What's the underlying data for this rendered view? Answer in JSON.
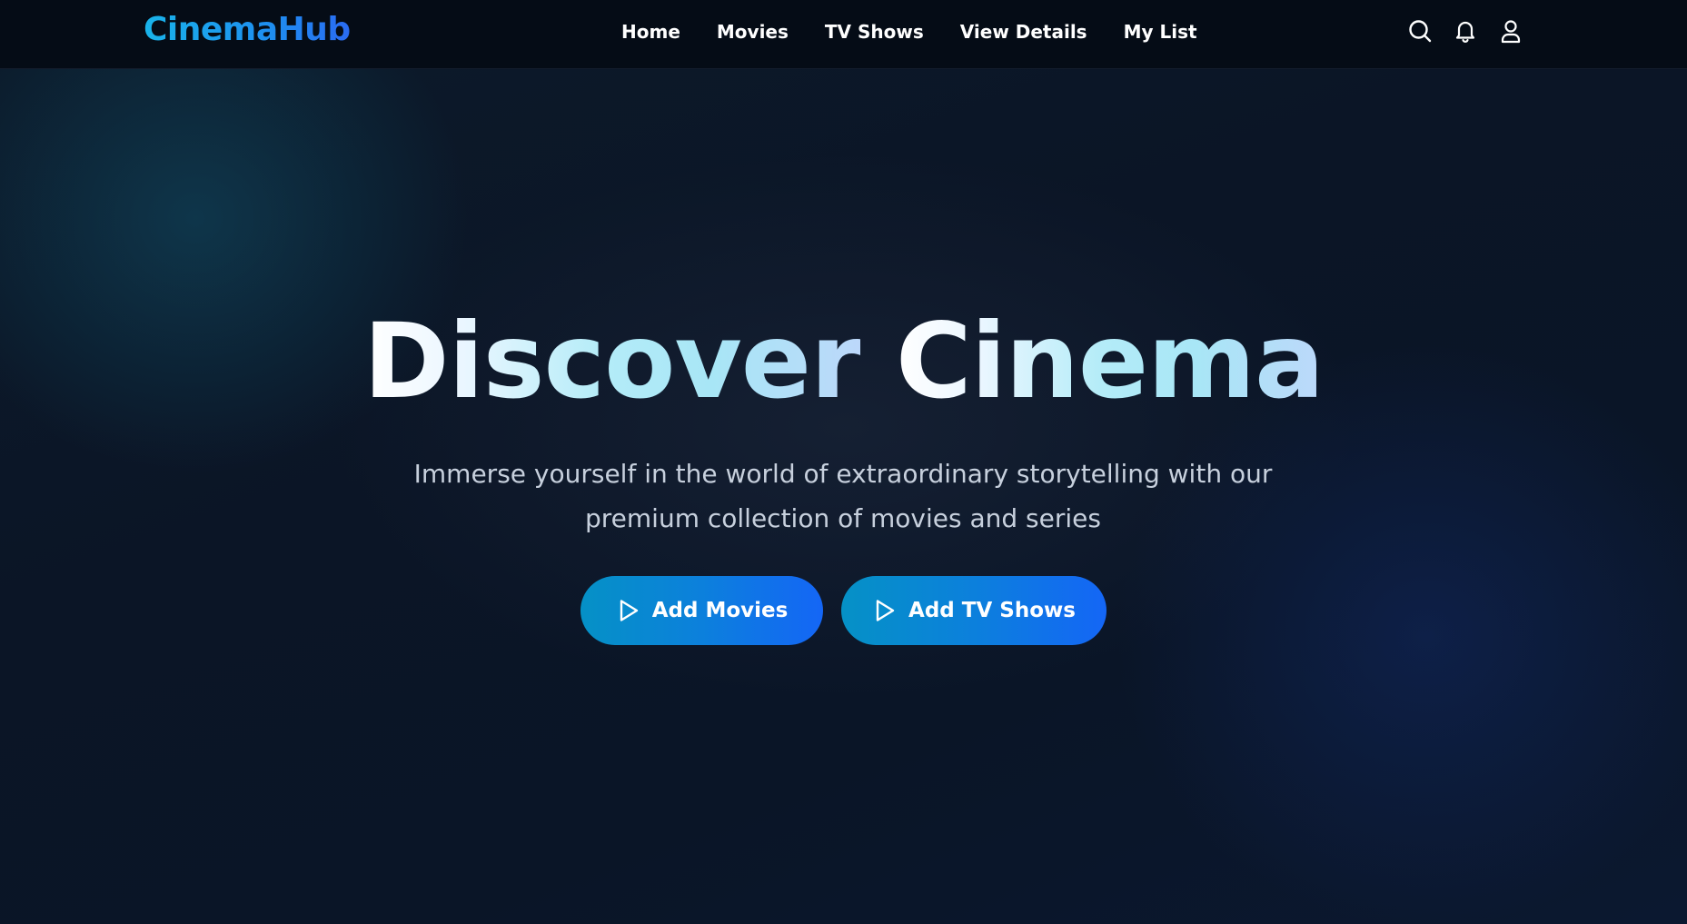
{
  "brand": {
    "name": "CinemaHub"
  },
  "nav": {
    "links": [
      {
        "label": "Home"
      },
      {
        "label": "Movies"
      },
      {
        "label": "TV Shows"
      },
      {
        "label": "View Details"
      },
      {
        "label": "My List"
      }
    ],
    "icons": [
      "search-icon",
      "bell-icon",
      "user-icon"
    ]
  },
  "hero": {
    "title_part1": "Discover",
    "title_part2": "Cinema",
    "subtitle_line1": "Immerse yourself in the world of extraordinary storytelling with our",
    "subtitle_line2": "premium collection of movies and series",
    "buttons": [
      {
        "label": "Add Movies",
        "icon": "play-icon"
      },
      {
        "label": "Add TV Shows",
        "icon": "play-icon"
      }
    ]
  },
  "colors": {
    "background": "#0b1424",
    "navbar": "#050c16",
    "brand_start": "#19b4ea",
    "brand_end": "#2a6bf2",
    "button_start": "#0591c6",
    "button_end": "#1466f6",
    "subtitle": "#c7d0dd"
  }
}
